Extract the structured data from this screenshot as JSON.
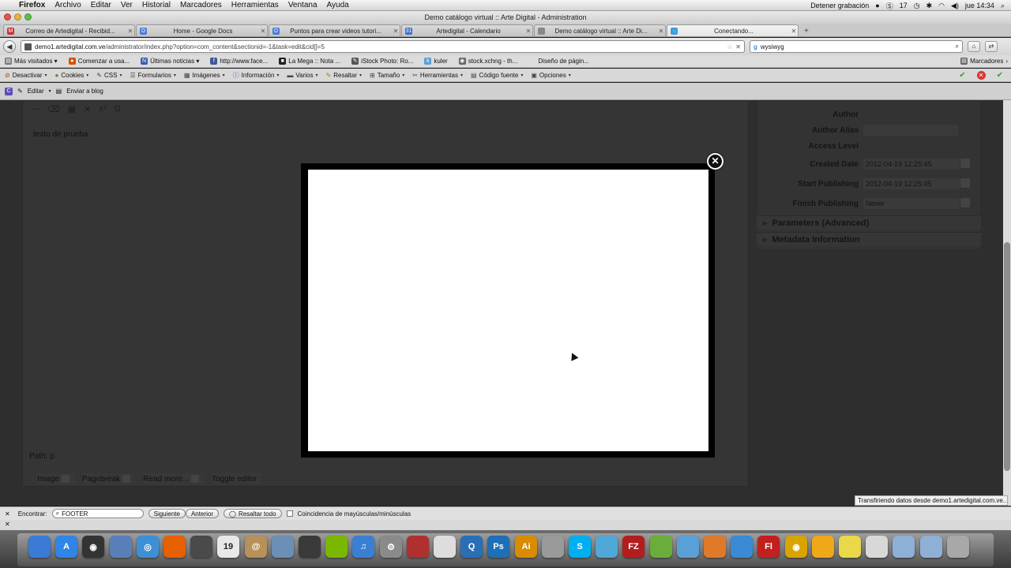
{
  "menubar": {
    "app": "Firefox",
    "items": [
      "Archivo",
      "Editar",
      "Ver",
      "Historial",
      "Marcadores",
      "Herramientas",
      "Ventana",
      "Ayuda"
    ],
    "recording": "Detener grabación",
    "badge": "17",
    "clock": "jue 14:34"
  },
  "window": {
    "title": "Demo catálogo virtual :: Arte Digital - Administration"
  },
  "tabs": [
    {
      "label": "Correo de Artedigital - Recibid...",
      "color": "#cc3333",
      "glyph": "M"
    },
    {
      "label": "Home - Google Docs",
      "color": "#4a7bd8",
      "glyph": "D"
    },
    {
      "label": "Puntos para crear videos tutori...",
      "color": "#4a7bd8",
      "glyph": "D"
    },
    {
      "label": "Artedigital - Calendario",
      "color": "#3b6fc9",
      "glyph": "31"
    },
    {
      "label": "Demo catálogo virtual :: Arte Di...",
      "color": "#888888",
      "glyph": ""
    },
    {
      "label": "Conectando...",
      "color": "#3d9be0",
      "glyph": "◌"
    }
  ],
  "nav": {
    "url_host": "demo1.artedigital.com.ve",
    "url_path": "/administrator/index.php?option=com_content&sectionid=-1&task=edit&cid[]=5",
    "search_value": "wysiwyg"
  },
  "bookmarks": {
    "items": [
      {
        "label": "Más visitados ▾",
        "color": "#777777",
        "glyph": "▤"
      },
      {
        "label": "Comenzar a usa...",
        "color": "#d35400",
        "glyph": "●"
      },
      {
        "label": "Últimas noticias ▾",
        "color": "#3a5db0",
        "glyph": "N"
      },
      {
        "label": "http://www.face...",
        "color": "#3b5998",
        "glyph": "f"
      },
      {
        "label": "La Mega :: Nota ...",
        "color": "#222222",
        "glyph": "■"
      },
      {
        "label": "iStock Photo: Ro...",
        "color": "#555555",
        "glyph": "✎"
      },
      {
        "label": "kuler",
        "color": "#5a9fd4",
        "glyph": "k"
      },
      {
        "label": "stock.xchng - th...",
        "color": "#666666",
        "glyph": "◉"
      },
      {
        "label": "Diseño de págin...",
        "color": "#dcdcdc",
        "glyph": ""
      }
    ],
    "right": "Marcadores"
  },
  "webdev": {
    "items": [
      {
        "label": "Desactivar",
        "glyph": "⊘",
        "color": "#c0392b"
      },
      {
        "label": "Cookies",
        "glyph": "●",
        "color": "#8e6b3a"
      },
      {
        "label": "CSS",
        "glyph": "✎",
        "color": "#444444"
      },
      {
        "label": "Formularios",
        "glyph": "☰",
        "color": "#444444"
      },
      {
        "label": "Imágenes",
        "glyph": "▦",
        "color": "#444444"
      },
      {
        "label": "Información",
        "glyph": "ⓘ",
        "color": "#2c5ea8"
      },
      {
        "label": "Varios",
        "glyph": "▬",
        "color": "#444444"
      },
      {
        "label": "Resaltar",
        "glyph": "✎",
        "color": "#aa7711"
      },
      {
        "label": "Tamaño",
        "glyph": "⊞",
        "color": "#444444"
      },
      {
        "label": "Herramientas",
        "glyph": "✂",
        "color": "#444444"
      },
      {
        "label": "Código fuente",
        "glyph": "▤",
        "color": "#444444"
      },
      {
        "label": "Opciones",
        "glyph": "▣",
        "color": "#444444"
      }
    ]
  },
  "blogbar": {
    "edit": "Editar",
    "send": "Enviar a blog"
  },
  "editor": {
    "sample_text": "texto de prueba",
    "path": "Path: p",
    "buttons": [
      "Image",
      "Pagebreak",
      "Read more...",
      "Toggle editor"
    ]
  },
  "details": {
    "fields": [
      {
        "label": "Author",
        "value": ""
      },
      {
        "label": "Author Alias",
        "value": ""
      },
      {
        "label": "Access Level",
        "value": ""
      },
      {
        "label": "Created Date",
        "value": "2012-04-19 12:25:45"
      },
      {
        "label": "Start Publishing",
        "value": "2012-04-19 12:25:45"
      },
      {
        "label": "Finish Publishing",
        "value": "Never"
      }
    ],
    "sections": [
      "Parameters (Advanced)",
      "Metadata Information"
    ]
  },
  "modal": {
    "close_glyph": "✕"
  },
  "findbar": {
    "label": "Encontrar:",
    "value": "FOOTER",
    "next": "Siguiente",
    "prev": "Anterior",
    "highlight": "Resaltar todo",
    "match_case": "Coincidencia de mayúsculas/minúsculas"
  },
  "status": {
    "text": "Transfiriendo datos desde demo1.artedigital.com.ve..."
  },
  "dock": [
    {
      "name": "finder-icon",
      "color": "#3a7bd5",
      "glyph": ""
    },
    {
      "name": "app-store-icon",
      "color": "#2f86e6",
      "glyph": "A"
    },
    {
      "name": "dashboard-icon",
      "color": "#333333",
      "glyph": "◉"
    },
    {
      "name": "mail-stamp-icon",
      "color": "#5a7fb8",
      "glyph": ""
    },
    {
      "name": "safari-icon",
      "color": "#3d8fd6",
      "glyph": "◎"
    },
    {
      "name": "firefox-icon",
      "color": "#e66000",
      "glyph": ""
    },
    {
      "name": "facetime-icon",
      "color": "#4a4a4a",
      "glyph": ""
    },
    {
      "name": "calendar-icon",
      "color": "#e8e8e8",
      "glyph": "19"
    },
    {
      "name": "address-book-icon",
      "color": "#b8905a",
      "glyph": "@"
    },
    {
      "name": "photo-icon",
      "color": "#6b8fb5",
      "glyph": ""
    },
    {
      "name": "adium-icon",
      "color": "#3a3a3a",
      "glyph": ""
    },
    {
      "name": "spotify-icon",
      "color": "#7ab800",
      "glyph": ""
    },
    {
      "name": "itunes-icon",
      "color": "#3b7fd4",
      "glyph": "♫"
    },
    {
      "name": "system-preferences-icon",
      "color": "#8a8a8a",
      "glyph": "⚙"
    },
    {
      "name": "photo-booth-icon",
      "color": "#b03030",
      "glyph": ""
    },
    {
      "name": "textedit-icon",
      "color": "#dddddd",
      "glyph": ""
    },
    {
      "name": "quicktime-icon",
      "color": "#2a6fb5",
      "glyph": "Q"
    },
    {
      "name": "photoshop-icon",
      "color": "#1d6fb8",
      "glyph": "Ps"
    },
    {
      "name": "illustrator-icon",
      "color": "#d98c00",
      "glyph": "Ai"
    },
    {
      "name": "calculator-icon",
      "color": "#9a9a9a",
      "glyph": ""
    },
    {
      "name": "skype-icon",
      "color": "#00aff0",
      "glyph": "S"
    },
    {
      "name": "dreamweaver-icon",
      "color": "#4fa8d6",
      "glyph": ""
    },
    {
      "name": "filezilla-icon",
      "color": "#b31d1d",
      "glyph": "FZ"
    },
    {
      "name": "pinwheel-icon",
      "color": "#6aad3a",
      "glyph": ""
    },
    {
      "name": "people-icon",
      "color": "#5aa0d8",
      "glyph": ""
    },
    {
      "name": "fireworks-icon",
      "color": "#e07a2a",
      "glyph": ""
    },
    {
      "name": "globe-icon",
      "color": "#3a8ad6",
      "glyph": ""
    },
    {
      "name": "flash-icon",
      "color": "#c21f1f",
      "glyph": "Fl"
    },
    {
      "name": "chrome-icon",
      "color": "#d9a400",
      "glyph": "◉"
    },
    {
      "name": "adobe-app-icon",
      "color": "#f0a818",
      "glyph": ""
    },
    {
      "name": "stickies-icon",
      "color": "#e8d84a",
      "glyph": ""
    },
    {
      "name": "script-editor-icon",
      "color": "#d8d8d8",
      "glyph": ""
    },
    {
      "name": "applications-folder-icon",
      "color": "#8fb0d6",
      "glyph": ""
    },
    {
      "name": "documents-folder-icon",
      "color": "#8fb0d6",
      "glyph": ""
    },
    {
      "name": "trash-icon",
      "color": "#a8a8a8",
      "glyph": ""
    }
  ]
}
